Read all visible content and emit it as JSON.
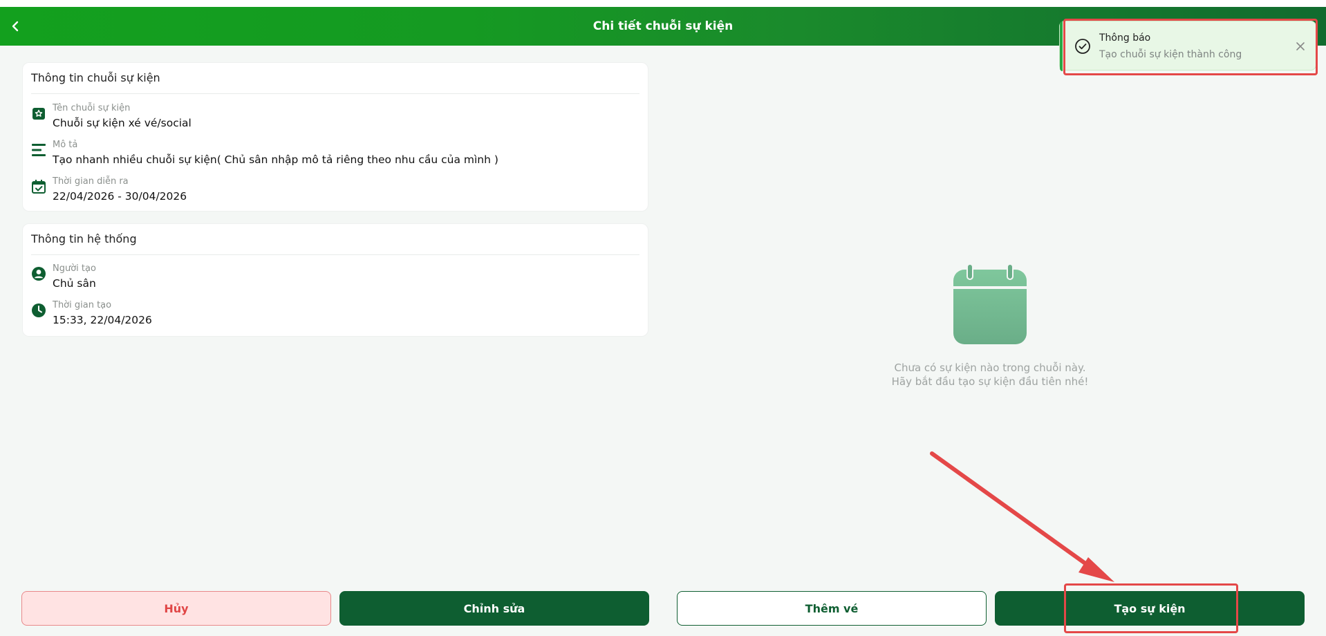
{
  "header": {
    "title": "Chi tiết chuỗi sự kiện"
  },
  "event_info": {
    "title": "Thông tin chuỗi sự kiện",
    "fields": [
      {
        "label": "Tên chuỗi sự kiện",
        "value": "Chuỗi sự kiện xé vé/social",
        "icon": "star-badge-icon"
      },
      {
        "label": "Mô tả",
        "value": "Tạo nhanh nhiều chuỗi sự kiện( Chủ sân nhập mô tả riêng theo nhu cầu của mình )",
        "icon": "description-lines-icon"
      },
      {
        "label": "Thời gian diễn ra",
        "value": "22/04/2026 - 30/04/2026",
        "icon": "calendar-check-icon"
      }
    ]
  },
  "system_info": {
    "title": "Thông tin hệ thống",
    "fields": [
      {
        "label": "Người tạo",
        "value": "Chủ sân",
        "icon": "user-circle-icon"
      },
      {
        "label": "Thời gian tạo",
        "value": "15:33, 22/04/2026",
        "icon": "clock-icon"
      }
    ]
  },
  "empty_state": {
    "line1": "Chưa có sự kiện nào trong chuỗi này.",
    "line2": "Hãy bắt đầu tạo sự kiện đầu tiên nhé!",
    "icon": "calendar-empty-icon"
  },
  "actions": {
    "cancel": "Hủy",
    "edit": "Chỉnh sửa",
    "add_ticket": "Thêm vé",
    "create_event": "Tạo sự kiện"
  },
  "toast": {
    "title": "Thông báo",
    "message": "Tạo chuỗi sự kiện thành công"
  },
  "colors": {
    "brand_dark": "#0e5e31",
    "brand_bright": "#13a01e",
    "danger": "#e04646",
    "annotation": "#e44848"
  }
}
